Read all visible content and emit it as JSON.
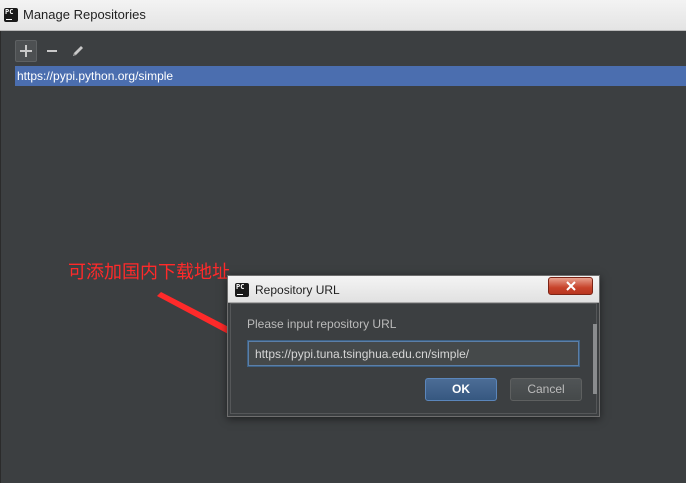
{
  "window": {
    "title": "Manage Repositories"
  },
  "toolbar": {
    "add_icon": "plus-icon",
    "remove_icon": "minus-icon",
    "edit_icon": "pencil-icon"
  },
  "repositories": [
    {
      "url": "https://pypi.python.org/simple",
      "selected": true
    }
  ],
  "annotation": {
    "text": "可添加国内下载地址",
    "color": "#ff2a2a"
  },
  "dialog": {
    "title": "Repository URL",
    "prompt": "Please input repository URL",
    "input_value": "https://pypi.tuna.tsinghua.edu.cn/simple/",
    "ok_label": "OK",
    "cancel_label": "Cancel",
    "close_label": "x"
  },
  "colors": {
    "background": "#3c3f41",
    "selection": "#4b6eaf",
    "accent": "#365880"
  }
}
